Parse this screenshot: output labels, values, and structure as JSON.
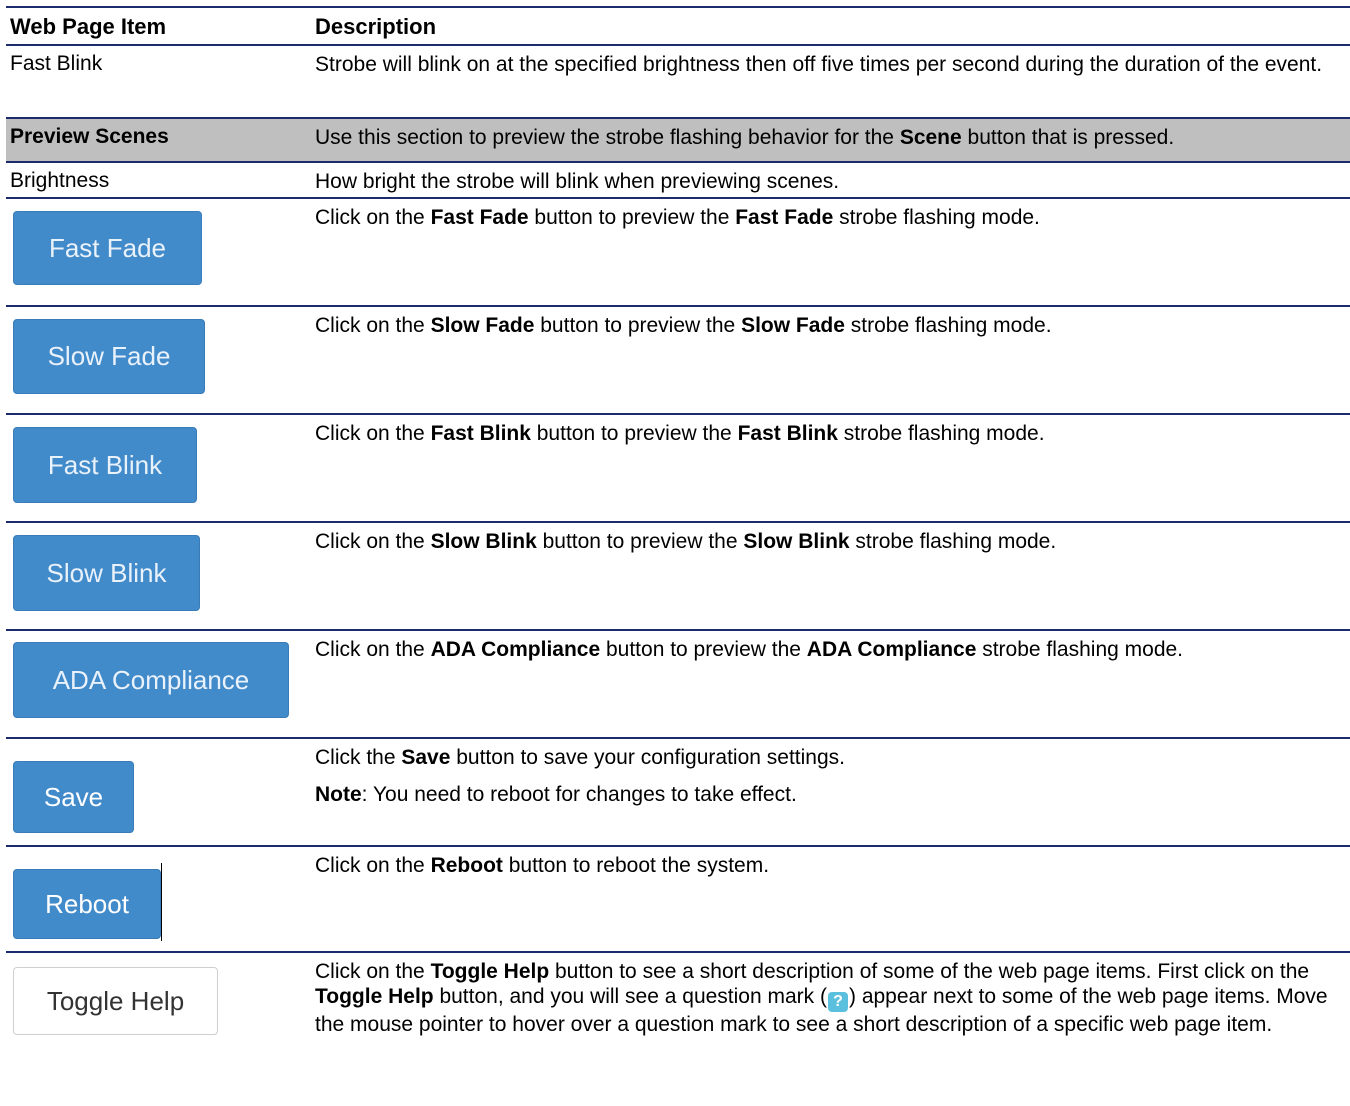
{
  "header": {
    "col1": "Web Page Item",
    "col2": "Description"
  },
  "fast_blink": {
    "item": "Fast Blink",
    "desc": "Strobe will blink on at the specified brightness then off five times per second during the duration of the event."
  },
  "preview": {
    "item": "Preview Scenes",
    "desc_a": "Use this section to preview the strobe flashing behavior for the ",
    "desc_b": "Scene",
    "desc_c": " button that is pressed."
  },
  "brightness": {
    "item": "Brightness",
    "desc": "How bright the strobe will blink when previewing scenes."
  },
  "fast_fade": {
    "button": "Fast Fade",
    "d1": "Click on the ",
    "d2": "Fast Fade",
    "d3": " button to preview the ",
    "d4": "Fast Fade",
    "d5": " strobe flashing mode."
  },
  "slow_fade": {
    "button": "Slow Fade",
    "d1": "Click on the ",
    "d2": "Slow Fade",
    "d3": " button to preview the ",
    "d4": "Slow Fade",
    "d5": " strobe flashing mode."
  },
  "fast_blink_btn": {
    "button": "Fast Blink",
    "d1": "Click on the ",
    "d2": "Fast Blink",
    "d3": " button to preview the ",
    "d4": "Fast Blink",
    "d5": " strobe flashing mode."
  },
  "slow_blink": {
    "button": "Slow Blink",
    "d1": "Click on the ",
    "d2": "Slow Blink",
    "d3": " button to preview the ",
    "d4": "Slow Blink",
    "d5": " strobe flashing mode."
  },
  "ada": {
    "button": "ADA Compliance",
    "d1": "Click on the ",
    "d2": "ADA Compliance",
    "d3": " button to preview the ",
    "d4": "ADA Compliance",
    "d5": " strobe flashing mode."
  },
  "save": {
    "button": "Save",
    "d1": "Click the ",
    "d2": "Save",
    "d3": " button to save your configuration settings.",
    "note_label": "Note",
    "note_text": ": You need to reboot for changes to take effect."
  },
  "reboot": {
    "button": "Reboot",
    "d1": "Click on the ",
    "d2": "Reboot",
    "d3": " button to reboot the system."
  },
  "toggle": {
    "button": "Toggle Help",
    "d1": "Click on the ",
    "d2": "Toggle Help",
    "d3": " button to see a short description of some of the web page items. First click on the ",
    "d4": "Toggle Help",
    "d5": " button, and you will see a question mark (",
    "qmark": "?",
    "d6": ") appear next to some of the web page items. Move the mouse pointer to hover over a question mark to see a short description of a specific web page item."
  },
  "colors": {
    "rule": "#1c2a6e",
    "button_blue": "#428bca",
    "preview_bg": "#bfbfbf",
    "qmark_bg": "#5bc0de"
  }
}
